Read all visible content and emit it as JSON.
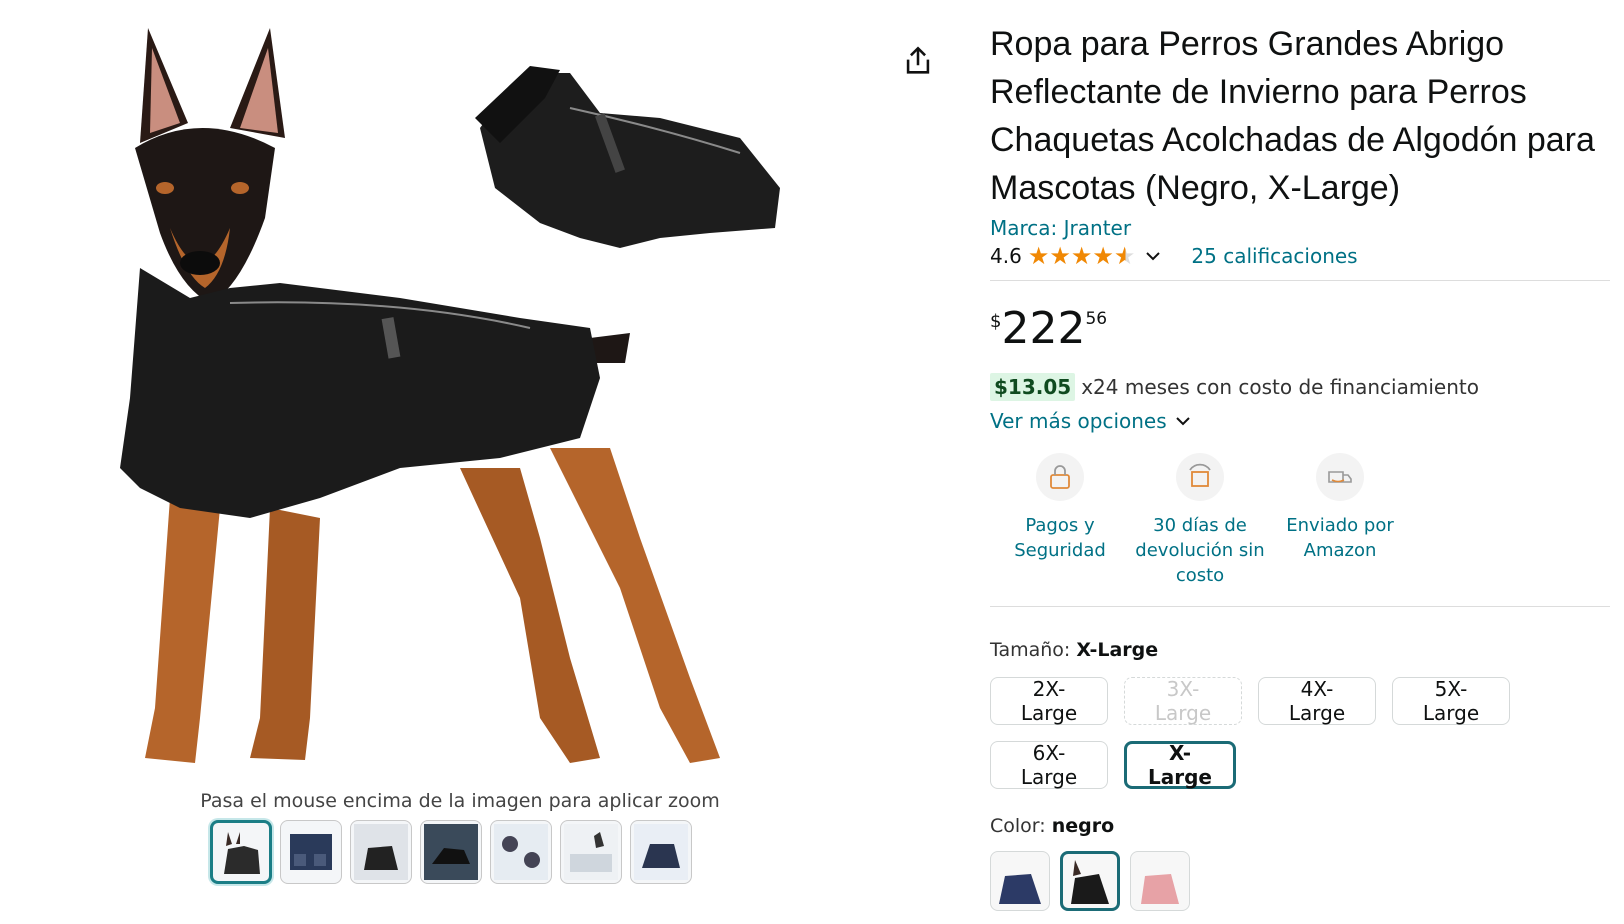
{
  "product": {
    "title": "Ropa para Perros Grandes Abrigo Reflectante de Invierno para Perros Chaquetas Acolchadas de Algodón para Mascotas (Negro, X-Large)",
    "brand": "Marca: Jranter",
    "rating": "4.6",
    "ratings_count": "25 calificaciones",
    "star_rating_value": 4.6
  },
  "price": {
    "symbol": "$",
    "whole": "222",
    "fraction": "56"
  },
  "financing": {
    "amount": "$13.05",
    "text": "x24 meses con costo de financiamiento",
    "more_options": "Ver más opciones"
  },
  "features": [
    {
      "label": "Pagos y Seguridad",
      "icon": "lock-card-icon"
    },
    {
      "label": "30 días de devolución sin costo",
      "icon": "return-box-icon"
    },
    {
      "label": "Enviado por Amazon",
      "icon": "delivery-truck-icon"
    }
  ],
  "size": {
    "label": "Tamaño:",
    "selected": "X-Large",
    "options": [
      "2X-Large",
      "3X-Large",
      "4X-Large",
      "5X-Large",
      "6X-Large",
      "X-Large"
    ]
  },
  "color": {
    "label": "Color:",
    "selected": "negro"
  },
  "gallery": {
    "zoom_hint": "Pasa el mouse encima de la imagen para aplicar zoom"
  },
  "colors": {
    "link": "#007185",
    "star": "#f08804",
    "selected_border": "#1b6b76"
  }
}
